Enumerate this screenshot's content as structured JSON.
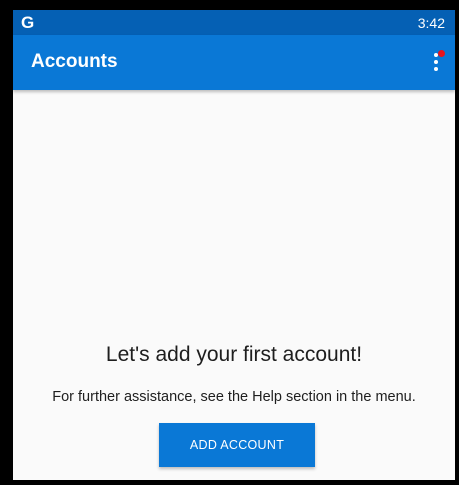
{
  "status_bar": {
    "app_icon_letter": "G",
    "time": "3:42"
  },
  "app_bar": {
    "title": "Accounts",
    "menu_icon": "more-vert-icon",
    "notification_badge_color": "#e8141d"
  },
  "empty_state": {
    "heading": "Let's add your first account!",
    "help_text": "For further assistance, see the Help section in the menu.",
    "button_label": "ADD ACCOUNT"
  },
  "colors": {
    "status_bar": "#0560b4",
    "app_bar": "#0a78d6",
    "button": "#0a78d6",
    "background": "#fafafa"
  }
}
